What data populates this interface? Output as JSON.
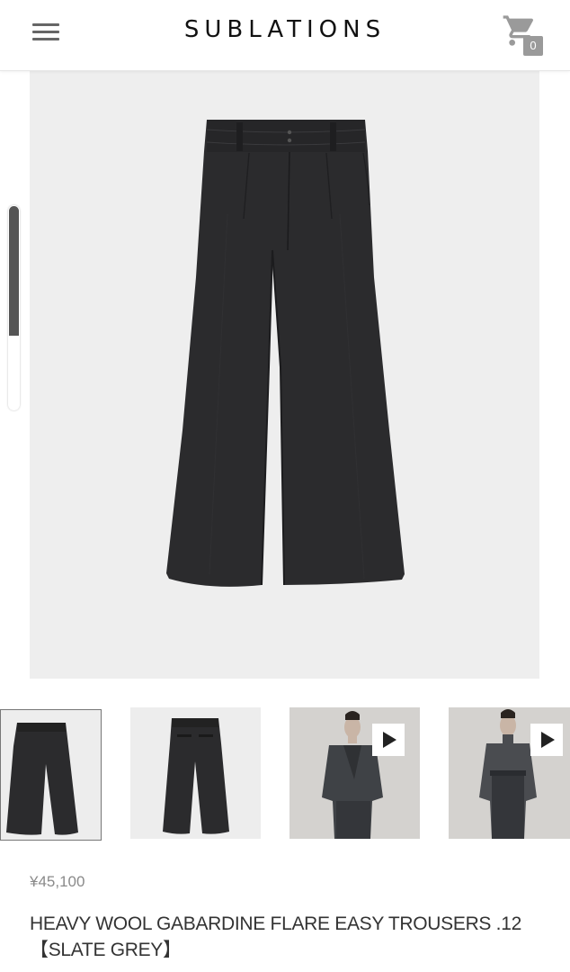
{
  "header": {
    "brand": "SUBLATIONS",
    "cart_count": "0",
    "menu_icon": "hamburger-menu-icon",
    "cart_icon": "shopping-cart-icon"
  },
  "gallery": {
    "thumbnails": [
      {
        "kind": "image",
        "subject": "trousers-front",
        "selected": true
      },
      {
        "kind": "image",
        "subject": "trousers-back",
        "selected": false
      },
      {
        "kind": "video",
        "subject": "model-jacket",
        "selected": false
      },
      {
        "kind": "video",
        "subject": "model-turtleneck",
        "selected": false
      }
    ],
    "scroll_position": 0.63
  },
  "product": {
    "price": "¥45,100",
    "title_line1": "HEAVY WOOL GABARDINE FLARE EASY TROUSERS .12",
    "title_line2": "【SLATE GREY】"
  },
  "colors": {
    "garment": "#2b2b2d",
    "image_background": "#eeeeee",
    "badge": "#9a9a9a",
    "text": "#333333",
    "price_text": "#8a8a8a"
  }
}
